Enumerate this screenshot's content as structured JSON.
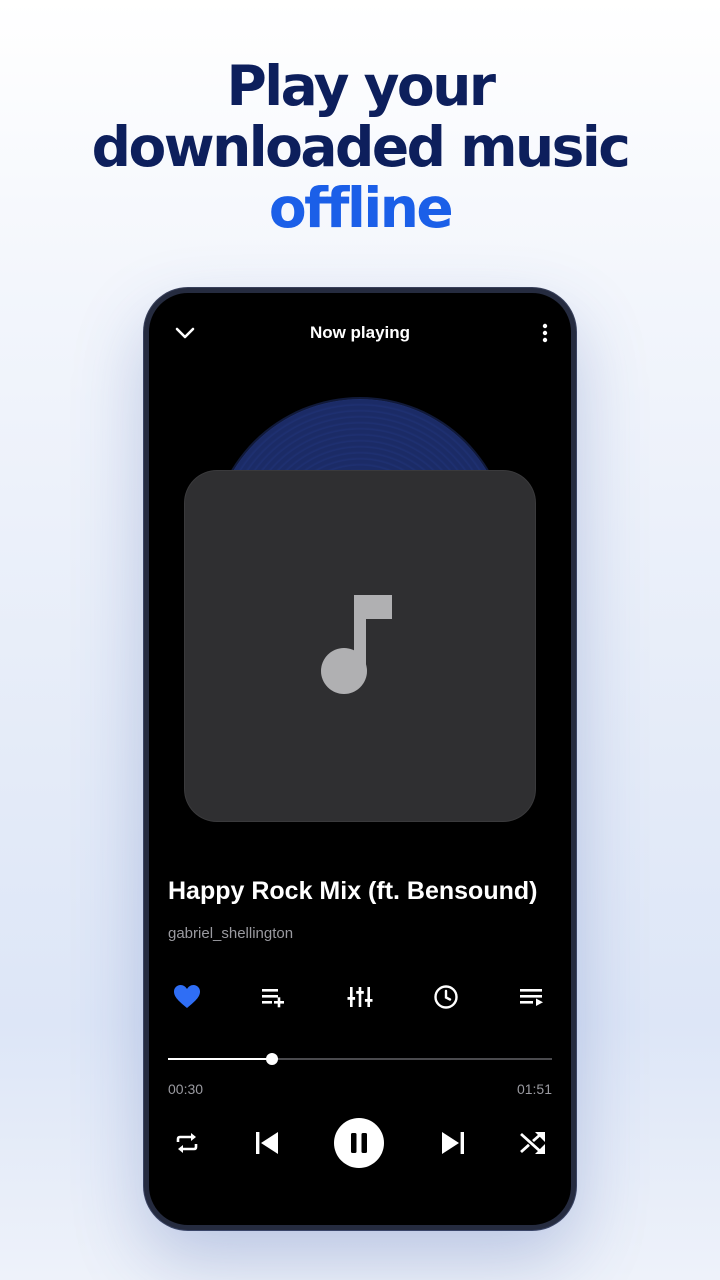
{
  "promo": {
    "line1": "Play your",
    "line2": "downloaded music",
    "line3": "offline"
  },
  "player": {
    "title": "Now playing",
    "track": {
      "name": "Happy Rock Mix (ft. Bensound)",
      "artist": "gabriel_shellington",
      "elapsed": "00:30",
      "duration": "01:51",
      "progress": 0.27
    },
    "actions": [
      {
        "icon": "heart-icon",
        "active": true
      },
      {
        "icon": "playlist-add-icon",
        "active": false
      },
      {
        "icon": "equalizer-icon",
        "active": false
      },
      {
        "icon": "sleep-timer-icon",
        "active": false
      },
      {
        "icon": "queue-icon",
        "active": false
      }
    ],
    "controls": [
      "repeat-icon",
      "previous-icon",
      "pause-icon",
      "next-icon",
      "shuffle-icon"
    ],
    "is_playing": true
  },
  "colors": {
    "headline": "#0d1f5c",
    "accent": "#1b5fe8",
    "heart": "#2f6ef5",
    "screen_bg": "#000000",
    "card_bg": "#2f2f31",
    "vinyl": "#1b2b66"
  }
}
